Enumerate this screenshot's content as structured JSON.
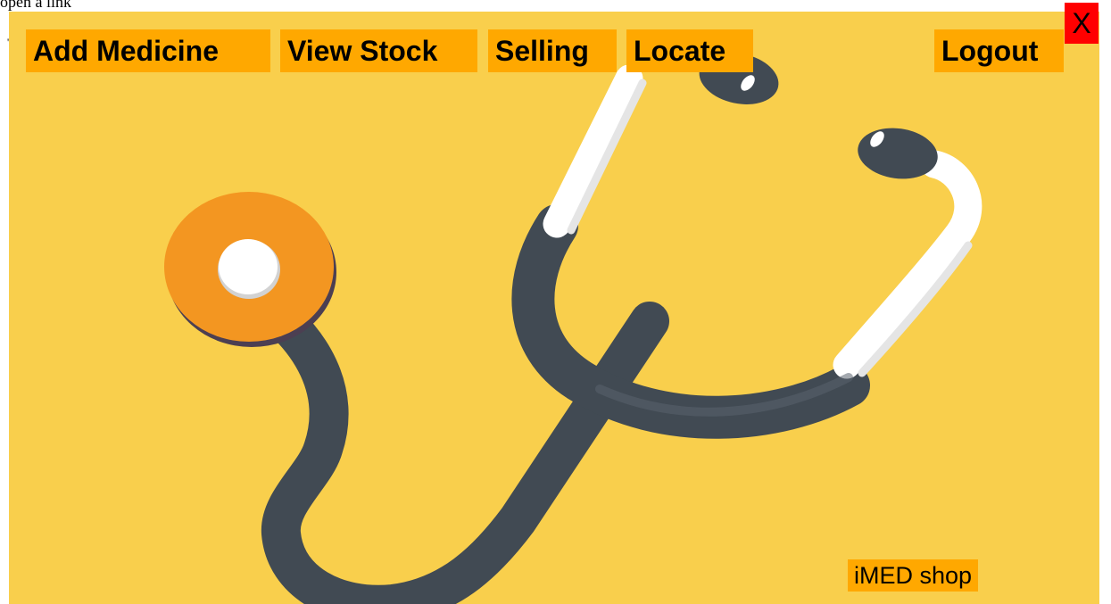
{
  "page": {
    "top_text": "open a link",
    "small_mark": "'",
    "close_label": "X"
  },
  "nav": {
    "add_medicine": "Add Medicine",
    "view_stock": "View Stock",
    "selling": "Selling",
    "locate": "Locate",
    "logout": "Logout"
  },
  "footer": {
    "shop_label": "iMED shop"
  },
  "colors": {
    "background": "#f9cf4c",
    "nav_button": "#ffa800",
    "close_button": "#ff0000",
    "stethoscope_dark": "#414a53",
    "stethoscope_white": "#ffffff",
    "chest_piece": "#f39621"
  },
  "icons": {
    "background_image": "stethoscope-illustration"
  }
}
